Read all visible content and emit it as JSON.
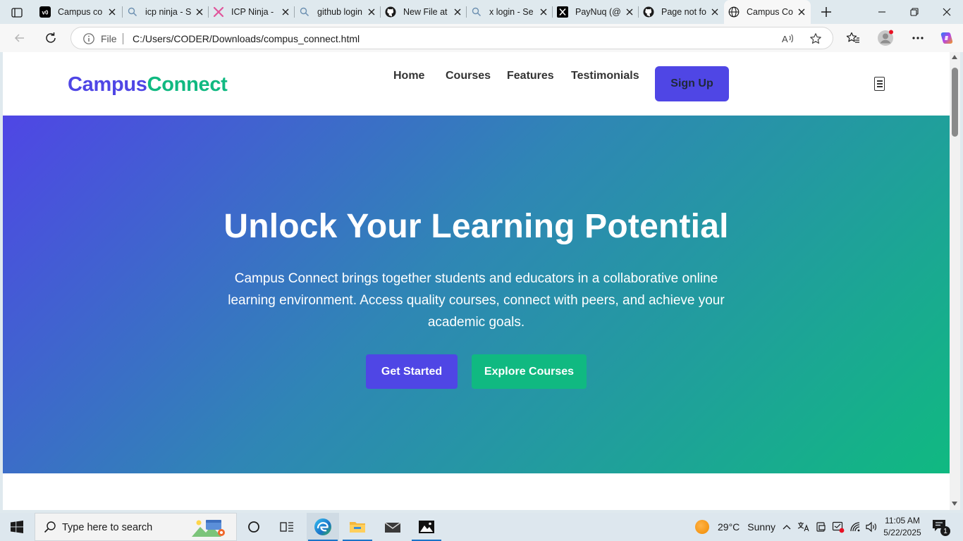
{
  "browser": {
    "tabs": [
      {
        "title": "Campus co",
        "icon": "v0-logo-icon"
      },
      {
        "title": "icp ninja - S",
        "icon": "search-icon"
      },
      {
        "title": "ICP Ninja -",
        "icon": "icp-ninja-icon"
      },
      {
        "title": "github login",
        "icon": "search-icon"
      },
      {
        "title": "New File at",
        "icon": "github-icon"
      },
      {
        "title": "x login - Se",
        "icon": "search-icon"
      },
      {
        "title": "PayNuq (@",
        "icon": "x-logo-icon"
      },
      {
        "title": "Page not fo",
        "icon": "github-icon"
      },
      {
        "title": "Campus Co",
        "icon": "globe-icon",
        "active": true
      }
    ],
    "address": {
      "scheme_label": "File",
      "url": "C:/Users/CODER/Downloads/compus_connect.html"
    }
  },
  "site": {
    "logo": {
      "part1": "Campus",
      "part2": "Connect"
    },
    "nav": [
      "Home",
      "Courses",
      "Features",
      "Testimonials"
    ],
    "signup_label": "Sign Up",
    "hero": {
      "title": "Unlock Your Learning Potential",
      "subtitle": "Campus Connect brings together students and educators in a collaborative online learning environment. Access quality courses, connect with peers, and achieve your academic goals.",
      "primary_button": "Get Started",
      "secondary_button": "Explore Courses"
    },
    "colors": {
      "primary": "#4f46e5",
      "secondary": "#10b981"
    }
  },
  "taskbar": {
    "search_placeholder": "Type here to search",
    "weather": {
      "temp": "29°C",
      "condition": "Sunny"
    },
    "clock": {
      "time": "11:05 AM",
      "date": "5/22/2025"
    },
    "notification_count": "1"
  }
}
